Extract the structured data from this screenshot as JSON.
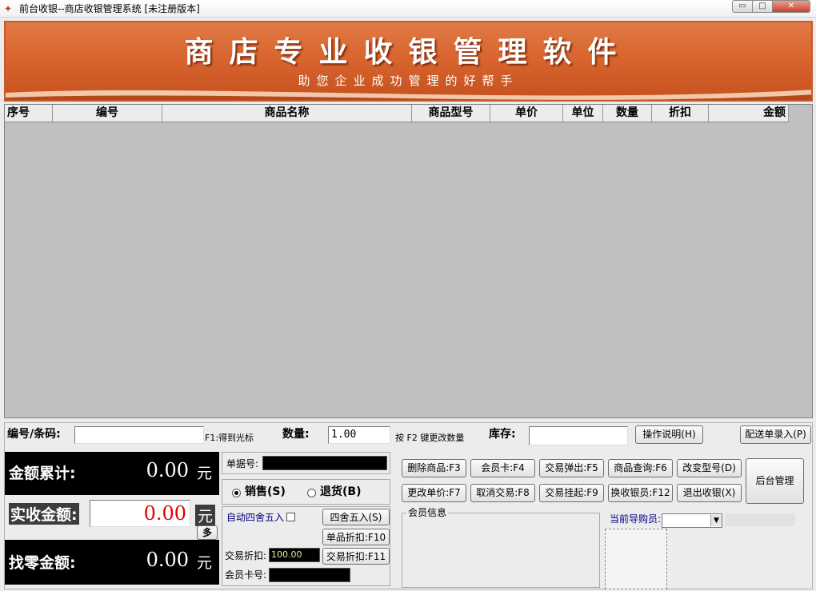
{
  "window": {
    "title": "前台收银--商店收银管理系统 [未注册版本]",
    "minimize": "▭",
    "maximize": "□",
    "close": "✕"
  },
  "banner": {
    "title": "商店专业收银管理软件",
    "subtitle": "助您企业成功管理的好帮手"
  },
  "grid": {
    "columns": [
      "序号",
      "编号",
      "商品名称",
      "商品型号",
      "单价",
      "单位",
      "数量",
      "折扣",
      "金额"
    ],
    "rows": []
  },
  "entry": {
    "barcode_label": "编号/条码:",
    "barcode_value": "",
    "f1_hint": "F1:得到光标",
    "qty_label": "数量:",
    "qty_value": "1.00",
    "f2_hint": "按 F2 键更改数量",
    "stock_label": "库存:",
    "stock_value": "",
    "help_button": "操作说明(H)",
    "delivery_button": "配送单录入(P)"
  },
  "totals": {
    "sum_label": "金额累计:",
    "sum_value": "0.00",
    "sum_unit": "元",
    "paid_label": "实收金额:",
    "paid_value": "0.00",
    "paid_unit": "元",
    "more_button": "多",
    "change_label": "找零金额:",
    "change_value": "0.00",
    "change_unit": "元"
  },
  "middle": {
    "receipt_label": "单据号:",
    "receipt_value": "",
    "sale_label": "销售(S)",
    "return_label": "退货(B)",
    "round_label": "自动四舍五入",
    "round_button": "四舍五入(S)",
    "item_discount_button": "单品折扣:F10",
    "trade_discount_label": "交易折扣:",
    "trade_discount_value": "100.00",
    "trade_discount_button": "交易折扣:F11",
    "member_card_label": "会员卡号:",
    "member_card_value": ""
  },
  "actions": {
    "row1": [
      "删除商品:F3",
      "会员卡:F4",
      "交易弹出:F5",
      "商品查询:F6",
      "改变型号(D)"
    ],
    "row2": [
      "更改单价:F7",
      "取消交易:F8",
      "交易挂起:F9",
      "换收银员:F12",
      "退出收银(X)"
    ],
    "backend_button": "后台管理"
  },
  "member_info": {
    "label": "会员信息"
  },
  "guide": {
    "label": "当前导购员:",
    "value": ""
  },
  "colors": {
    "banner": "#d9652f",
    "grid_bg": "#c0c0c0",
    "paid_value": "#e00000",
    "round_label": "#000080"
  }
}
